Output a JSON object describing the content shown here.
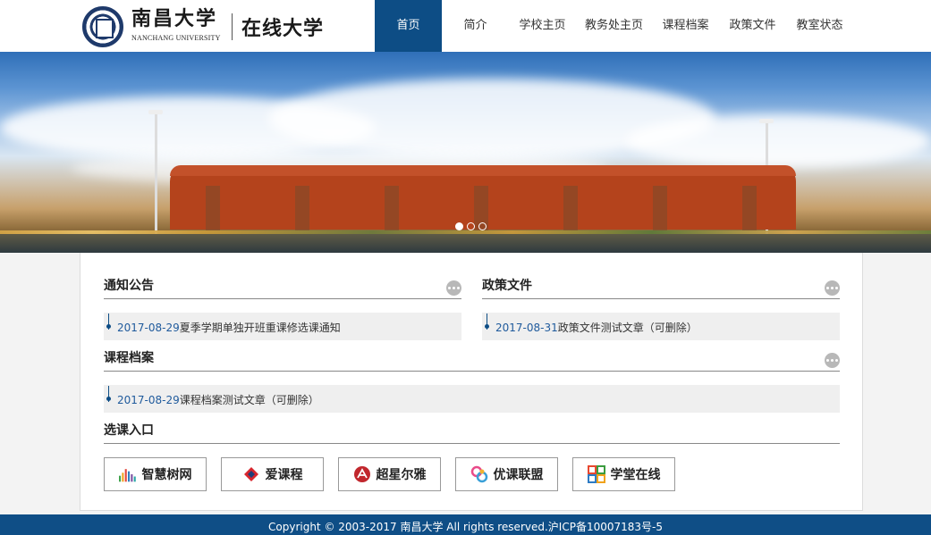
{
  "brand": {
    "logo_cn": "南昌大学",
    "logo_en": "NANCHANG UNIVERSITY",
    "subtitle": "在线大学"
  },
  "nav": [
    {
      "label": "首页",
      "active": true
    },
    {
      "label": "简介",
      "active": false
    },
    {
      "label": "学校主页",
      "active": false
    },
    {
      "label": "教务处主页",
      "active": false
    },
    {
      "label": "课程档案",
      "active": false
    },
    {
      "label": "政策文件",
      "active": false
    },
    {
      "label": "教室状态",
      "active": false
    }
  ],
  "banner": {
    "slides": 3,
    "active_slide": 1
  },
  "sections": {
    "notice": {
      "title": "通知公告",
      "items": [
        {
          "date": "2017-08-29",
          "text": "夏季学期单独开班重课修选课通知"
        }
      ]
    },
    "policy": {
      "title": "政策文件",
      "items": [
        {
          "date": "2017-08-31",
          "text": "政策文件测试文章（可删除）"
        }
      ]
    },
    "archive": {
      "title": "课程档案",
      "items": [
        {
          "date": "2017-08-29",
          "text": "课程档案测试文章（可删除）"
        }
      ]
    },
    "entry": {
      "title": "选课入口",
      "portals": [
        {
          "name": "智慧树网",
          "icon": "bar-chart-logo-icon"
        },
        {
          "name": "爱课程",
          "icon": "icourse-logo-icon"
        },
        {
          "name": "超星尔雅",
          "icon": "chaoxing-logo-icon"
        },
        {
          "name": "优课联盟",
          "icon": "uooc-logo-icon"
        },
        {
          "name": "学堂在线",
          "icon": "xuetang-logo-icon"
        }
      ]
    }
  },
  "footer": {
    "text": "Copyright © 2003-2017 南昌大学 All rights reserved.沪ICP备10007183号-5"
  },
  "colors": {
    "primary": "#0d4d85",
    "footer": "#0f4e86",
    "link_date": "#1f5a9c"
  }
}
